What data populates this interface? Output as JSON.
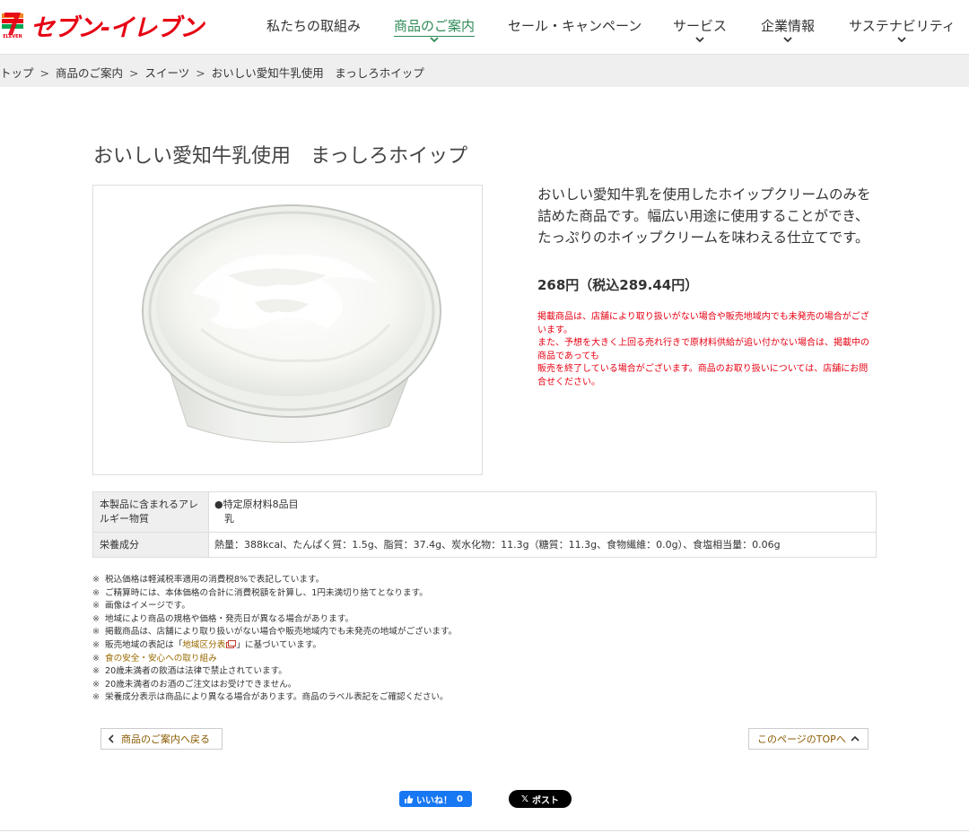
{
  "brand": {
    "name": "セブン-イレブン",
    "logo_mark_text": "ELEVEN",
    "color": "#e60012"
  },
  "nav": {
    "items": [
      {
        "label": "私たちの取組み",
        "has_chevron": false
      },
      {
        "label": "商品のご案内",
        "has_chevron": true,
        "active": true
      },
      {
        "label": "セール・キャンペーン",
        "has_chevron": false
      },
      {
        "label": "サービス",
        "has_chevron": true
      },
      {
        "label": "企業情報",
        "has_chevron": true
      },
      {
        "label": "サステナビリティ",
        "has_chevron": true
      }
    ],
    "active_color": "#2e8b57"
  },
  "breadcrumb": {
    "items": [
      "トップ",
      "商品のご案内",
      "スイーツ",
      "おいしい愛知牛乳使用　まっしろホイップ"
    ],
    "separator": ">"
  },
  "product": {
    "title": "おいしい愛知牛乳使用　まっしろホイップ",
    "description": "おいしい愛知牛乳を使用したホイップクリームのみを詰めた商品です。幅広い用途に使用することができ、たっぷりのホイップクリームを味わえる仕立てです。",
    "price": "268円（税込289.44円）",
    "warnings": [
      "掲載商品は、店舗により取り扱いがない場合や販売地域内でも未発売の場合がございます。",
      "また、予想を大きく上回る売れ行きで原材料供給が追い付かない場合は、掲載中の商品であっても",
      "販売を終了している場合がございます。商品のお取り扱いについては、店舗にお問合せください。"
    ],
    "warning_color": "#e60012"
  },
  "info_table": {
    "allergy_label": "本製品に含まれるアレルギー物質",
    "allergy_heading": "●特定原材料8品目",
    "allergy_value": "乳",
    "nutrition_label": "栄養成分",
    "nutrition_value": "熱量：388kcal、たんぱく質：1.5g、脂質：37.4g、炭水化物：11.3g（糖質：11.3g、食物繊維：0.0g）、食塩相当量：0.06g"
  },
  "notes": {
    "mark": "※",
    "items": [
      "税込価格は軽減税率適用の消費税8%で表記しています。",
      "ご精算時には、本体価格の合計に消費税額を計算し、1円未満切り捨てとなります。",
      "画像はイメージです。",
      "地域により商品の規格や価格・発売日が異なる場合があります。",
      "掲載商品は、店舗により取り扱いがない場合や販売地域内でも未発売の地域がございます。"
    ],
    "region_prefix": "販売地域の表記は「",
    "region_link": "地域区分表",
    "region_suffix": "」に基づいています。",
    "safety_link": "食の安全・安心への取り組み",
    "items_after": [
      "20歳未満者の飲酒は法律で禁止されています。",
      "20歳未満者のお酒のご注文はお受けできません。",
      "栄養成分表示は商品により異なる場合があります。商品のラベル表記をご確認ください。"
    ],
    "link_color": "#9a6a00"
  },
  "buttons": {
    "back": "商品のご案内へ戻る",
    "page_top": "このページのTOPへ"
  },
  "social": {
    "like_label": "いいね！",
    "like_count": "0",
    "post_label": "ポスト",
    "post_logo": "𝕏"
  }
}
